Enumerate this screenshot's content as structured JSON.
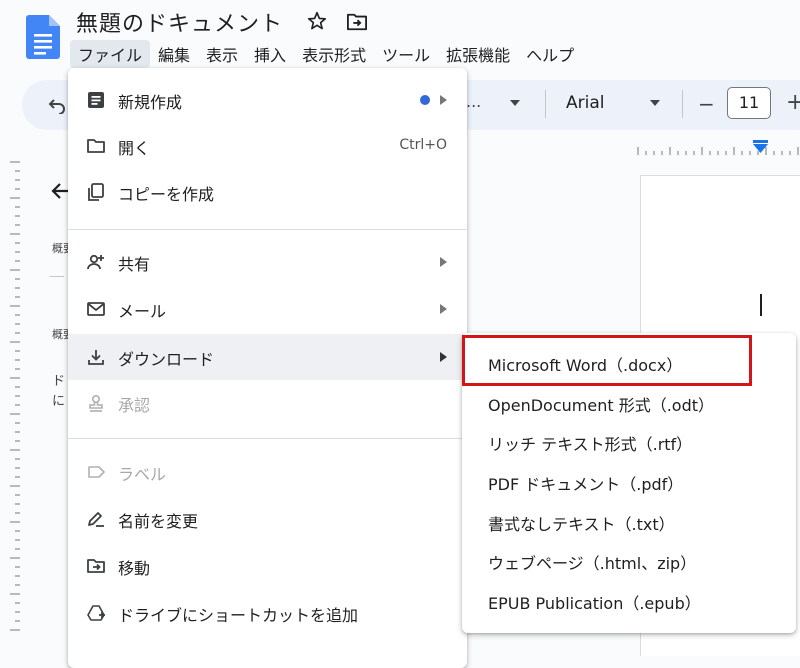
{
  "document": {
    "title": "無題のドキュメント"
  },
  "menubar": {
    "items": [
      {
        "label": "ファイル",
        "active": true
      },
      {
        "label": "編集"
      },
      {
        "label": "表示"
      },
      {
        "label": "挿入"
      },
      {
        "label": "表示形式"
      },
      {
        "label": "ツール"
      },
      {
        "label": "拡張機能"
      },
      {
        "label": "ヘルプ"
      }
    ]
  },
  "toolbar": {
    "style_value": "...",
    "font_name": "Arial",
    "font_size": "11",
    "minus": "−",
    "plus": "+"
  },
  "outline": {
    "item1": "概要",
    "item2": "概要",
    "text1": "ド",
    "text2": "に"
  },
  "file_menu": {
    "new": "新規作成",
    "open": "開く",
    "open_shortcut": "Ctrl+O",
    "copy": "コピーを作成",
    "share": "共有",
    "email": "メール",
    "download": "ダウンロード",
    "approve": "承認",
    "label": "ラベル",
    "rename": "名前を変更",
    "move": "移動",
    "add_shortcut": "ドライブにショートカットを追加"
  },
  "download_submenu": {
    "items": [
      "Microsoft Word（.docx）",
      "OpenDocument 形式（.odt）",
      "リッチ テキスト形式（.rtf）",
      "PDF ドキュメント（.pdf）",
      "書式なしテキスト（.txt）",
      "ウェブページ（.html、zip）",
      "EPUB Publication（.epub）"
    ]
  },
  "colors": {
    "docs_blue": "#4285f4",
    "highlight_red": "#d3151b",
    "dot_blue": "#3268d7"
  },
  "icons": {
    "logo": "google-docs-icon",
    "star": "star-icon",
    "move": "move-to-folder-icon"
  }
}
